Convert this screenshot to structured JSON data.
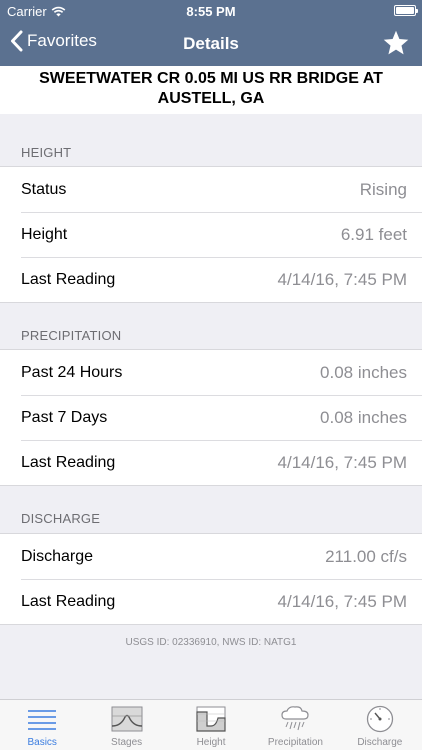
{
  "status_bar": {
    "carrier": "Carrier",
    "time": "8:55 PM"
  },
  "nav": {
    "back_label": "Favorites",
    "title": "Details"
  },
  "station": {
    "name": "SWEETWATER CR 0.05 MI US RR BRIDGE AT AUSTELL, GA"
  },
  "sections": {
    "height": {
      "title": "HEIGHT",
      "rows": [
        {
          "label": "Status",
          "value": "Rising"
        },
        {
          "label": "Height",
          "value": "6.91 feet"
        },
        {
          "label": "Last Reading",
          "value": "4/14/16, 7:45 PM"
        }
      ]
    },
    "precipitation": {
      "title": "PRECIPITATION",
      "rows": [
        {
          "label": "Past 24 Hours",
          "value": "0.08 inches"
        },
        {
          "label": "Past 7 Days",
          "value": "0.08 inches"
        },
        {
          "label": "Last Reading",
          "value": "4/14/16, 7:45 PM"
        }
      ]
    },
    "discharge": {
      "title": "DISCHARGE",
      "rows": [
        {
          "label": "Discharge",
          "value": "211.00 cf/s"
        },
        {
          "label": "Last Reading",
          "value": "4/14/16, 7:45 PM"
        }
      ]
    }
  },
  "footnote": "USGS ID: 02336910, NWS ID: NATG1",
  "tabs": [
    {
      "label": "Basics",
      "icon": "list-icon",
      "active": true
    },
    {
      "label": "Stages",
      "icon": "stages-chart-icon",
      "active": false
    },
    {
      "label": "Height",
      "icon": "height-chart-icon",
      "active": false
    },
    {
      "label": "Precipitation",
      "icon": "rain-cloud-icon",
      "active": false
    },
    {
      "label": "Discharge",
      "icon": "gauge-icon",
      "active": false
    }
  ],
  "colors": {
    "nav_bar": "#5b7190",
    "accent": "#3b7de0",
    "value_text": "#8e8e93",
    "background": "#efeff4"
  }
}
